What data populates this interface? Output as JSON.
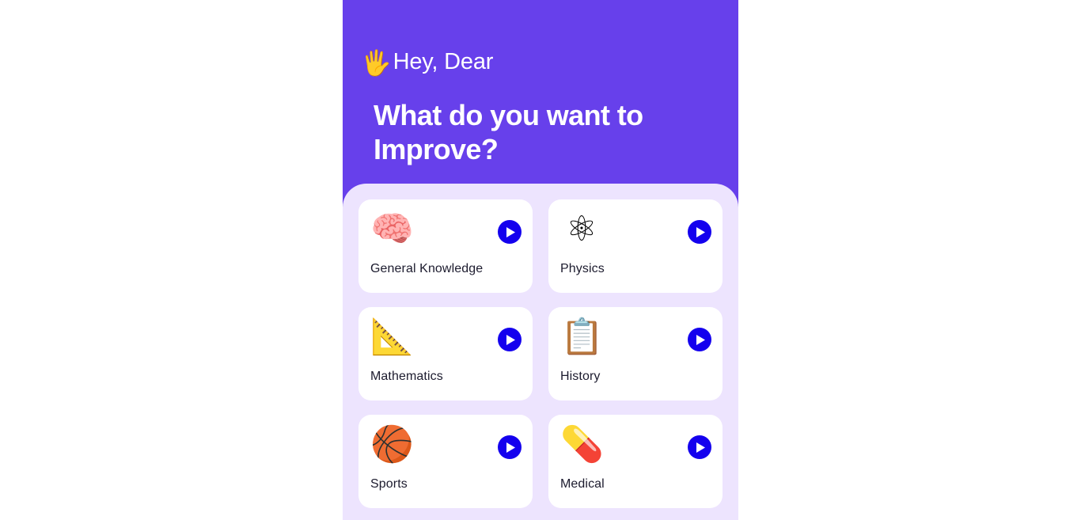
{
  "header": {
    "greeting_emoji": "🖐",
    "greeting_emoji_name": "raised-hand-emoji",
    "greeting_text": "Hey, Dear",
    "headline": "What do you want to Improve?",
    "background_color": "#6740EB"
  },
  "content": {
    "background_color": "#EDE4FE",
    "card_background_color": "#ffffff",
    "play_button_color": "#1400EE",
    "label_color": "#1c1b2e"
  },
  "categories": [
    {
      "label": "General Knowledge",
      "icon": "🧠",
      "icon_name": "brain-icon",
      "play_label": "play"
    },
    {
      "label": "Physics",
      "icon": "⚛",
      "icon_name": "atom-icon",
      "play_label": "play"
    },
    {
      "label": "Mathematics",
      "icon": "📐",
      "icon_name": "protractor-icon",
      "play_label": "play"
    },
    {
      "label": "History",
      "icon": "📋",
      "icon_name": "document-stopwatch-icon",
      "play_label": "play"
    },
    {
      "label": "Sports",
      "icon": "🏀",
      "icon_name": "basketball-jersey-icon",
      "play_label": "play"
    },
    {
      "label": "Medical",
      "icon": "💊",
      "icon_name": "pill-pack-icon",
      "play_label": "play"
    }
  ]
}
